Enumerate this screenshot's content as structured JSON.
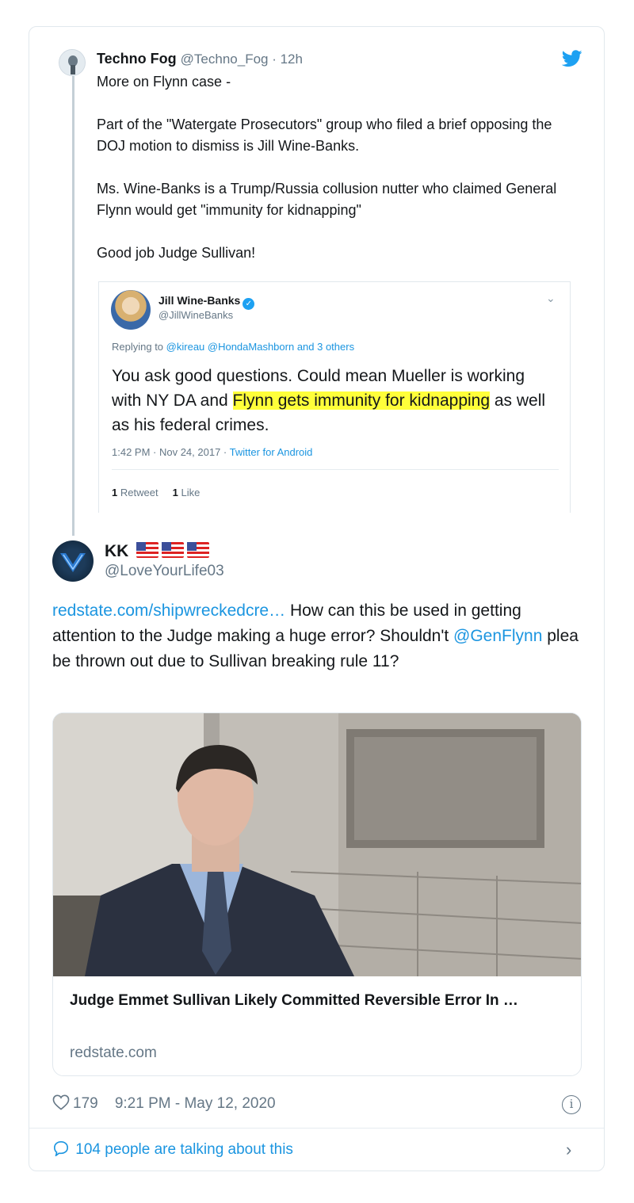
{
  "parent_tweet": {
    "name": "Techno Fog",
    "meta": "@Techno_Fog · 12h",
    "paragraphs": [
      "More on Flynn case -",
      "Part of the \"Watergate Prosecutors\" group who filed a brief opposing the DOJ motion to dismiss is Jill Wine-Banks.",
      "Ms. Wine-Banks is a Trump/Russia collusion nutter who claimed General Flynn would get \"immunity for kidnapping\"",
      "Good job Judge Sullivan!"
    ],
    "quoted": {
      "name": "Jill Wine-Banks",
      "handle": "@JillWineBanks",
      "reply_prefix": "Replying to",
      "reply_to": "@kireau @HondaMashborn and 3 others",
      "text_before": "You ask good questions. Could mean  Mueller is working with NY DA and ",
      "text_highlight": "Flynn gets immunity for kidnapping",
      "text_after": " as well as his federal crimes.",
      "time": "1:42 PM · Nov 24, 2017 · ",
      "client": "Twitter for Android",
      "retweets_count": "1",
      "retweets_label": "Retweet",
      "likes_count": "1",
      "likes_label": "Like"
    }
  },
  "main_tweet": {
    "name": "KK",
    "handle": "@LoveYourLife03",
    "link_text": "redstate.com/shipwreckedcre…",
    "text_1": " How can this be used in getting attention to the Judge making a huge error? Shouldn't ",
    "mention": "@GenFlynn",
    "text_2": " plea be thrown out due to Sullivan breaking rule 11?",
    "card": {
      "title": "Judge Emmet Sullivan Likely Committed Reversible Error In …",
      "domain": "redstate.com"
    },
    "likes": "179",
    "timestamp": "9:21 PM - May 12, 2020",
    "talking": "104 people are talking about this"
  },
  "colors": {
    "link": "#1b95e0",
    "twitter_blue": "#1da1f2",
    "highlight": "#ffff3a",
    "secondary_text": "#657786"
  }
}
